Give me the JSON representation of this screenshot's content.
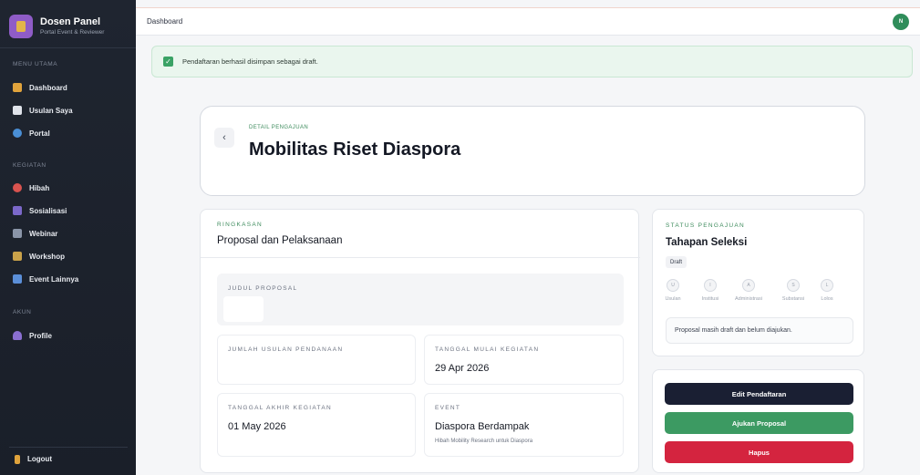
{
  "sidebar": {
    "brand_title": "Dosen Panel",
    "brand_subtitle": "Portal Event & Reviewer",
    "sections": [
      "MENU UTAMA",
      "KEGIATAN",
      "AKUN"
    ],
    "menu_utama": [
      "Dashboard",
      "Usulan Saya",
      "Portal"
    ],
    "kegiatan": [
      "Hibah",
      "Sosialisasi",
      "Webinar",
      "Workshop",
      "Event Lainnya"
    ],
    "akun": [
      "Profile"
    ],
    "logout_label": "Logout"
  },
  "topbar": {
    "breadcrumb": "Dashboard",
    "avatar_initial": "N"
  },
  "alert": {
    "message": "Pendaftaran berhasil disimpan sebagai draft."
  },
  "header": {
    "eyebrow": "DETAIL PENGAJUAN",
    "title": "Mobilitas Riset Diaspora"
  },
  "summary": {
    "kicker": "RINGKASAN",
    "title": "Proposal dan Pelaksanaan",
    "judul_label": "JUDUL PROPOSAL",
    "judul_value": "",
    "jumlah_label": "JUMLAH USULAN PENDANAAN",
    "jumlah_value": "",
    "mulai_label": "TANGGAL MULAI KEGIATAN",
    "mulai_value": "29 Apr 2026",
    "akhir_label": "TANGGAL AKHIR KEGIATAN",
    "akhir_value": "01 May 2026",
    "event_label": "EVENT",
    "event_value": "Diaspora Berdampak",
    "event_sub": "Hibah Mobility Research untuk Diaspora"
  },
  "status": {
    "kicker": "STATUS PENGAJUAN",
    "title": "Tahapan Seleksi",
    "badge": "Draft",
    "steps": [
      {
        "initial": "U",
        "label": "Usulan"
      },
      {
        "initial": "I",
        "label": "Institusi"
      },
      {
        "initial": "A",
        "label": "Administrasi"
      },
      {
        "initial": "S",
        "label": "Substansi"
      },
      {
        "initial": "L",
        "label": "Lolos"
      }
    ],
    "note": "Proposal masih draft dan belum diajukan."
  },
  "actions": {
    "edit": "Edit Pendaftaran",
    "submit": "Ajukan Proposal",
    "delete": "Hapus"
  },
  "colors": {
    "accent_green": "#3d8b5c",
    "button_dark": "#1a1f33",
    "button_green": "#3c9a62",
    "button_red": "#d4243f",
    "sidebar_bg": "#1f2530"
  }
}
